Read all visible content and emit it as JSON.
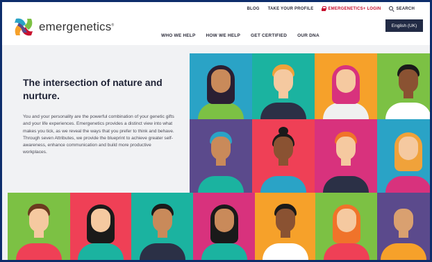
{
  "header": {
    "logo_text": "emergenetics",
    "logo_mark": "®",
    "utility": {
      "blog": "BLOG",
      "take_profile": "TAKE YOUR PROFILE",
      "login": "EMERGENETICS+ LOGIN",
      "search": "SEARCH"
    },
    "language": "English (UK)",
    "nav": [
      "WHO WE HELP",
      "HOW WE HELP",
      "GET CERTIFIED",
      "OUR DNA"
    ]
  },
  "hero": {
    "title": "The intersection of nature and nurture.",
    "body": "You and your personality are the powerful combination of your genetic gifts and your life experiences. Emergenetics provides a distinct view into what makes you tick, as we reveal the ways that you prefer to think and behave. Through seven Attributes, we provide the blueprint to achieve greater self-awareness, enhance communication and build more productive workplaces."
  },
  "colors": {
    "frame": "#0d2d6b",
    "brand_red": "#c8102e",
    "title": "#1e2235",
    "lang_bg": "#222b45"
  },
  "portraits": [
    {
      "name": "portrait-1",
      "bg": "#2aa3c6",
      "skin": "#c98a5a",
      "hair": "#2a1f33",
      "shirt": "#7cc144",
      "style": "long"
    },
    {
      "name": "portrait-2",
      "bg": "#1bb3a0",
      "skin": "#f5c9a0",
      "hair": "#f0a23a",
      "shirt": "#2b3046",
      "style": "short"
    },
    {
      "name": "portrait-3",
      "bg": "#f6a12a",
      "skin": "#f5c9a0",
      "hair": "#d8327d",
      "shirt": "#f0f0f0",
      "style": "long"
    },
    {
      "name": "portrait-4",
      "bg": "#7cc144",
      "skin": "#8a5232",
      "hair": "#1a1a1a",
      "shirt": "#ffffff",
      "style": "short"
    },
    {
      "name": "portrait-5",
      "bg": "#5b4a8c",
      "skin": "#c98a5a",
      "hair": "#2aa3c6",
      "shirt": "#1bb3a0",
      "style": "short"
    },
    {
      "name": "portrait-6",
      "bg": "#ef4056",
      "skin": "#8a5232",
      "hair": "#1a1a1a",
      "shirt": "#2aa3c6",
      "style": "bun"
    },
    {
      "name": "portrait-7",
      "bg": "#d8327d",
      "skin": "#f5c9a0",
      "hair": "#f0732a",
      "shirt": "#2b3046",
      "style": "short"
    },
    {
      "name": "portrait-8",
      "bg": "#2aa3c6",
      "skin": "#f5c9a0",
      "hair": "#f0a23a",
      "shirt": "#d8327d",
      "style": "long"
    },
    {
      "name": "portrait-9",
      "bg": "#7cc144",
      "skin": "#f5c9a0",
      "hair": "#6b3b1f",
      "shirt": "#ef4056",
      "style": "short"
    },
    {
      "name": "portrait-10",
      "bg": "#ef4056",
      "skin": "#f5c9a0",
      "hair": "#1a1a1a",
      "shirt": "#1bb3a0",
      "style": "long"
    },
    {
      "name": "portrait-11",
      "bg": "#1bb3a0",
      "skin": "#c98a5a",
      "hair": "#1a1a1a",
      "shirt": "#2b3046",
      "style": "short"
    },
    {
      "name": "portrait-12",
      "bg": "#d8327d",
      "skin": "#c98a5a",
      "hair": "#1a1a1a",
      "shirt": "#1bb3a0",
      "style": "long"
    },
    {
      "name": "portrait-13",
      "bg": "#f6a12a",
      "skin": "#8a5232",
      "hair": "#1a1a1a",
      "shirt": "#ffffff",
      "style": "short"
    },
    {
      "name": "portrait-14",
      "bg": "#7cc144",
      "skin": "#f5c9a0",
      "hair": "#f0732a",
      "shirt": "#ef4056",
      "style": "long"
    },
    {
      "name": "portrait-15",
      "bg": "#5b4a8c",
      "skin": "#d9a070",
      "hair": "#d9a070",
      "shirt": "#f6a12a",
      "style": "bald"
    }
  ]
}
